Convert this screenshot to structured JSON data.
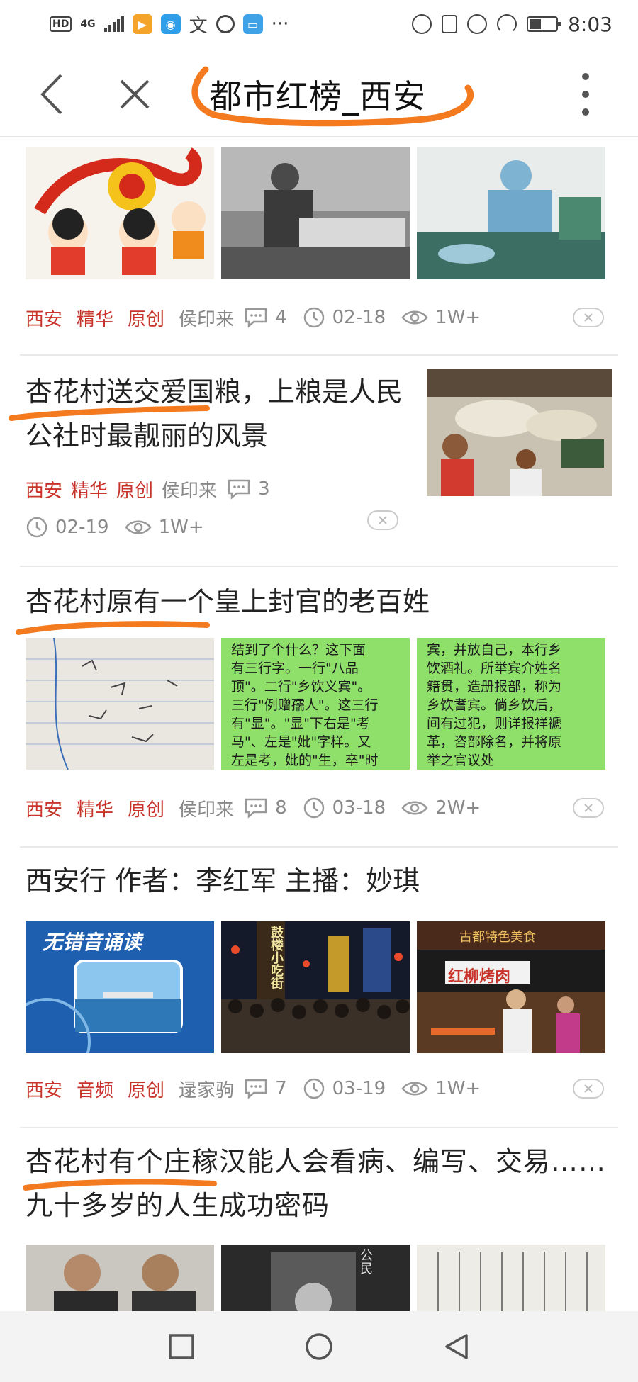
{
  "status_bar": {
    "hd": "HD",
    "network": "4G",
    "ellipsis": "···",
    "time": "8:03"
  },
  "nav": {
    "title": "都市红榜_西安"
  },
  "articles": [
    {
      "tags": [
        "西安",
        "精华",
        "原创"
      ],
      "author": "侯印来",
      "comments": "4",
      "date": "02-18",
      "views": "1W+"
    },
    {
      "title": "杏花村送交爱国粮，上粮是人民公社时最靓丽的风景",
      "tags": [
        "西安",
        "精华",
        "原创"
      ],
      "author": "侯印来",
      "comments": "3",
      "date": "02-19",
      "views": "1W+"
    },
    {
      "title": "杏花村原有一个皇上封官的老百姓",
      "tags": [
        "西安",
        "精华",
        "原创"
      ],
      "author": "侯印来",
      "comments": "8",
      "date": "03-18",
      "views": "2W+",
      "image_texts": {
        "middle": [
          "结到了个什么？这下面",
          "有三行字。一行\"八品",
          "顶\"。二行\"乡饮义宾\"。",
          "三行\"例赠孺人\"。这三行",
          "有\"显\"。\"显\"下右是\"考",
          "马\"、左是\"妣\"字样。又",
          "左是考，妣的\"生，卒\"时"
        ],
        "right": [
          "宾，并放自己，本行乡",
          "饮酒礼。所举宾介姓名",
          "籍贯，造册报部，称为",
          "乡饮耆宾。倘乡饮后，",
          "间有过犯，则详报祥褫",
          "革，咨部除名，并将原",
          "举之官议处"
        ]
      }
    },
    {
      "title": "西安行 作者：李红军 主播：妙琪",
      "tags": [
        "西安",
        "音频",
        "原创"
      ],
      "author": "逯家驹",
      "comments": "7",
      "date": "03-19",
      "views": "1W+",
      "image_texts": {
        "left": "无错音诵读",
        "middle": "鼓楼小吃街",
        "right_sign": "红柳烤肉",
        "right_top": "古都特色美食"
      }
    },
    {
      "title": "杏花村有个庄稼汉能人会看病、编写、交易……九十多岁的人生成功密码",
      "image_texts": {
        "middle": "公民"
      }
    }
  ],
  "colors": {
    "tag": "#c8342b",
    "meta": "#888888",
    "annotation": "#f47a1f",
    "title": "#222222"
  },
  "icons": [
    "signal-icon",
    "app-icon",
    "back-icon",
    "close-icon",
    "more-icon",
    "comment-icon",
    "clock-icon",
    "eye-icon",
    "dislike-icon",
    "square-nav-icon",
    "circle-nav-icon",
    "triangle-nav-icon"
  ]
}
